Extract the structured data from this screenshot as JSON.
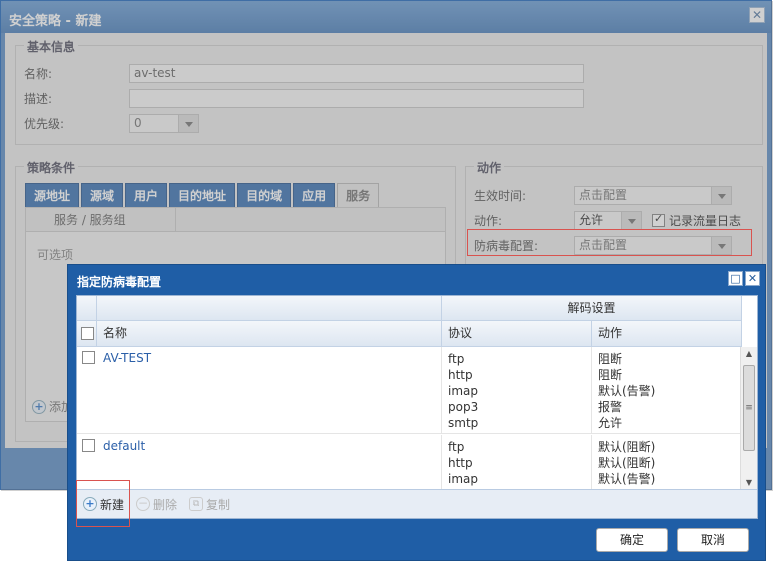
{
  "back_window": {
    "title": "安全策略 - 新建",
    "basic_info": {
      "legend": "基本信息",
      "name_label": "名称:",
      "name_value": "av-test",
      "desc_label": "描述:",
      "desc_value": "",
      "priority_label": "优先级:",
      "priority_value": "0"
    },
    "conditions": {
      "legend": "策略条件",
      "tabs": [
        "源地址",
        "源域",
        "用户",
        "目的地址",
        "目的域",
        "应用",
        "服务"
      ],
      "active_tab": "服务",
      "column_header": "服务 / 服务组",
      "optional_text": "可选项",
      "add_label": "添加"
    },
    "action": {
      "legend": "动作",
      "effective_time_label": "生效时间:",
      "effective_time_value": "点击配置",
      "action_label": "动作:",
      "action_value": "允许",
      "log_label": "记录流量日志",
      "antivirus_label": "防病毒配置:",
      "antivirus_value": "点击配置"
    }
  },
  "dialog": {
    "title": "指定防病毒配置",
    "group_header": "解码设置",
    "col_name": "名称",
    "col_protocol": "协议",
    "col_action": "动作",
    "rows": [
      {
        "name": "AV-TEST",
        "protocols": [
          "ftp",
          "http",
          "imap",
          "pop3",
          "smtp"
        ],
        "actions": [
          "阻断",
          "阻断",
          "默认(告警)",
          "报警",
          "允许"
        ]
      },
      {
        "name": "default",
        "protocols": [
          "ftp",
          "http",
          "imap"
        ],
        "actions": [
          "默认(阻断)",
          "默认(阻断)",
          "默认(告警)"
        ]
      }
    ],
    "toolbar": {
      "new_label": "新建",
      "delete_label": "删除",
      "copy_label": "复制"
    },
    "ok_label": "确定",
    "cancel_label": "取消"
  }
}
